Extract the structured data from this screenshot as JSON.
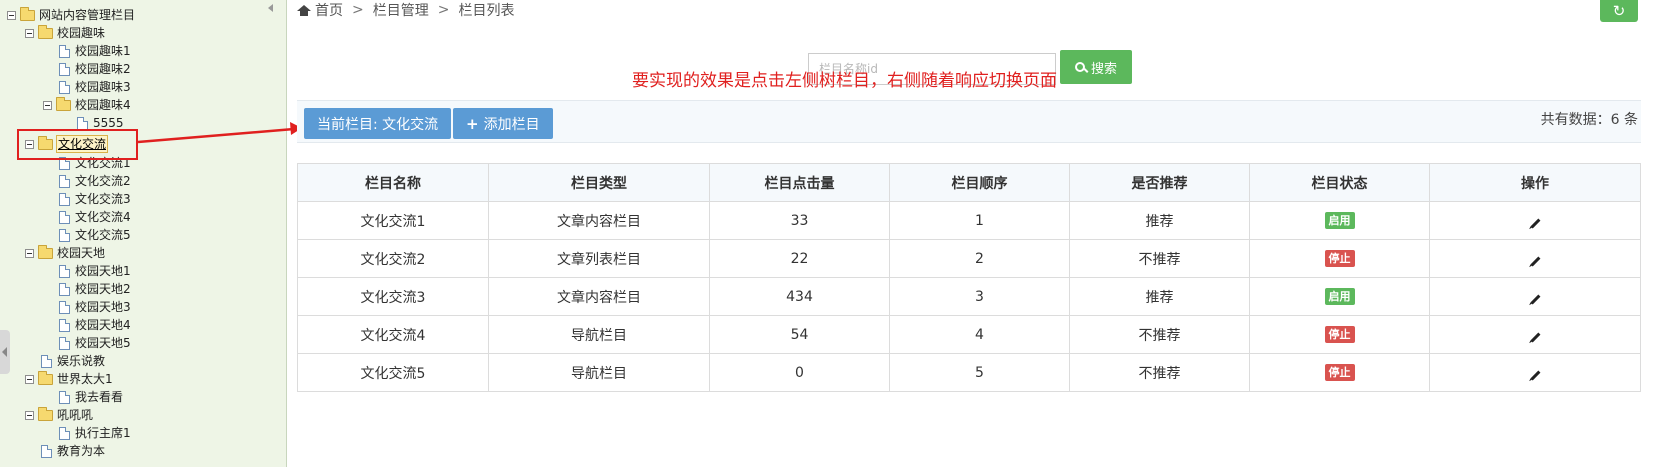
{
  "tree": {
    "root_label": "网站内容管理栏目",
    "nodes": [
      "校园趣味",
      "校园趣味1",
      "校园趣味2",
      "校园趣味3",
      "校园趣味4",
      "5555",
      "文化交流",
      "文化交流1",
      "文化交流2",
      "文化交流3",
      "文化交流4",
      "文化交流5",
      "校园天地",
      "校园天地1",
      "校园天地2",
      "校园天地3",
      "校园天地4",
      "校园天地5",
      "娱乐说教",
      "世界太大1",
      "我去看看",
      "吼吼吼",
      "执行主席1",
      "教育为本"
    ]
  },
  "breadcrumb": {
    "home": "首页",
    "sep": ">",
    "section": "栏目管理",
    "page": "栏目列表"
  },
  "search": {
    "placeholder": "栏目名称id",
    "button_label": "搜索"
  },
  "annotation_text": "要实现的效果是点击左侧树栏目，右侧随着响应切换页面",
  "toolbar": {
    "current_label": "当前栏目: 文化交流",
    "add_label": "添加栏目",
    "total_label": "共有数据：6 条"
  },
  "table": {
    "headers": [
      "栏目名称",
      "栏目类型",
      "栏目点击量",
      "栏目顺序",
      "是否推荐",
      "栏目状态",
      "操作"
    ],
    "rows": [
      {
        "name": "文化交流1",
        "type": "文章内容栏目",
        "clicks": "33",
        "order": "1",
        "recommend": "推荐",
        "status": "启用"
      },
      {
        "name": "文化交流2",
        "type": "文章列表栏目",
        "clicks": "22",
        "order": "2",
        "recommend": "不推荐",
        "status": "停止"
      },
      {
        "name": "文化交流3",
        "type": "文章内容栏目",
        "clicks": "434",
        "order": "3",
        "recommend": "推荐",
        "status": "启用"
      },
      {
        "name": "文化交流4",
        "type": "导航栏目",
        "clicks": "54",
        "order": "4",
        "recommend": "不推荐",
        "status": "停止"
      },
      {
        "name": "文化交流5",
        "type": "导航栏目",
        "clicks": "0",
        "order": "5",
        "recommend": "不推荐",
        "status": "停止"
      }
    ]
  },
  "colors": {
    "tree_bg": "#eef5e6",
    "primary": "#5b9bd5",
    "success": "#5cb85c",
    "danger": "#d9534f",
    "annotation": "#e0201f"
  }
}
